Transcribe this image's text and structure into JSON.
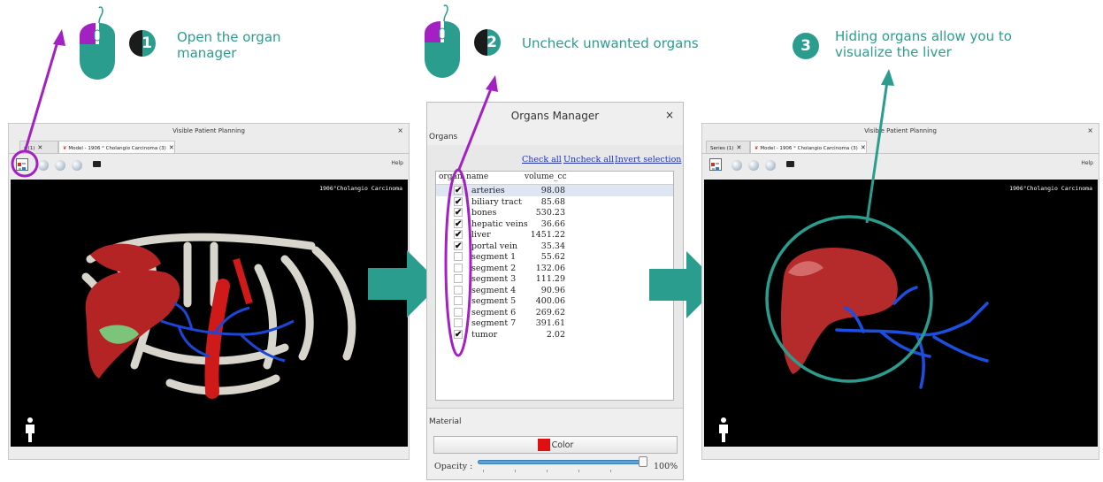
{
  "steps": [
    {
      "number": "1",
      "text_line1": "Open the organ",
      "text_line2": "manager"
    },
    {
      "number": "2",
      "text_line1": "Uncheck unwanted organs"
    },
    {
      "number": "3",
      "text_line1": "Hiding organs allow you to",
      "text_line2": "visualize the liver"
    }
  ],
  "left_window": {
    "title": "Visible Patient Planning",
    "close": "×",
    "tabs": [
      {
        "label": "s (1)",
        "close": "✕"
      },
      {
        "label": "Model - 1906 ° Cholangio Carcinoma (3)",
        "close": "✕"
      }
    ],
    "help": "Help",
    "viewport_label": "1906°Cholangio Carcinoma"
  },
  "right_window": {
    "title": "Visible Patient Planning",
    "close": "×",
    "tabs": [
      {
        "label": "Series (1)",
        "close": "✕"
      },
      {
        "label": "Model - 1906 ° Cholangio Carcinoma (3)",
        "close": "✕"
      }
    ],
    "help": "Help",
    "viewport_label": "1906°Cholangio Carcinoma"
  },
  "organs_manager": {
    "title": "Organs Manager",
    "close": "×",
    "section_organs": "Organs",
    "links": {
      "check_all": "Check all",
      "uncheck_all": "Uncheck all",
      "invert": "Invert selection"
    },
    "columns": {
      "organ": "organ_name",
      "volume": "volume_cc"
    },
    "rows": [
      {
        "name": "arteries",
        "volume": "98.08",
        "checked": true
      },
      {
        "name": "biliary tract",
        "volume": "85.68",
        "checked": true
      },
      {
        "name": "bones",
        "volume": "530.23",
        "checked": true
      },
      {
        "name": "hepatic veins",
        "volume": "36.66",
        "checked": true
      },
      {
        "name": "liver",
        "volume": "1451.22",
        "checked": true
      },
      {
        "name": "portal vein",
        "volume": "35.34",
        "checked": true
      },
      {
        "name": "segment 1",
        "volume": "55.62",
        "checked": false
      },
      {
        "name": "segment 2",
        "volume": "132.06",
        "checked": false
      },
      {
        "name": "segment 3",
        "volume": "111.29",
        "checked": false
      },
      {
        "name": "segment 4",
        "volume": "90.96",
        "checked": false
      },
      {
        "name": "segment 5",
        "volume": "400.06",
        "checked": false
      },
      {
        "name": "segment 6",
        "volume": "269.62",
        "checked": false
      },
      {
        "name": "segment 7",
        "volume": "391.61",
        "checked": false
      },
      {
        "name": "tumor",
        "volume": "2.02",
        "checked": true
      }
    ],
    "section_material": "Material",
    "color_button": "Color",
    "opacity_label": "Opacity :",
    "opacity_value": "100%",
    "opacity_fraction": 1.0
  },
  "colors": {
    "teal": "#2a9d8f",
    "purple": "#a321c2",
    "swatch": "#e01010"
  }
}
